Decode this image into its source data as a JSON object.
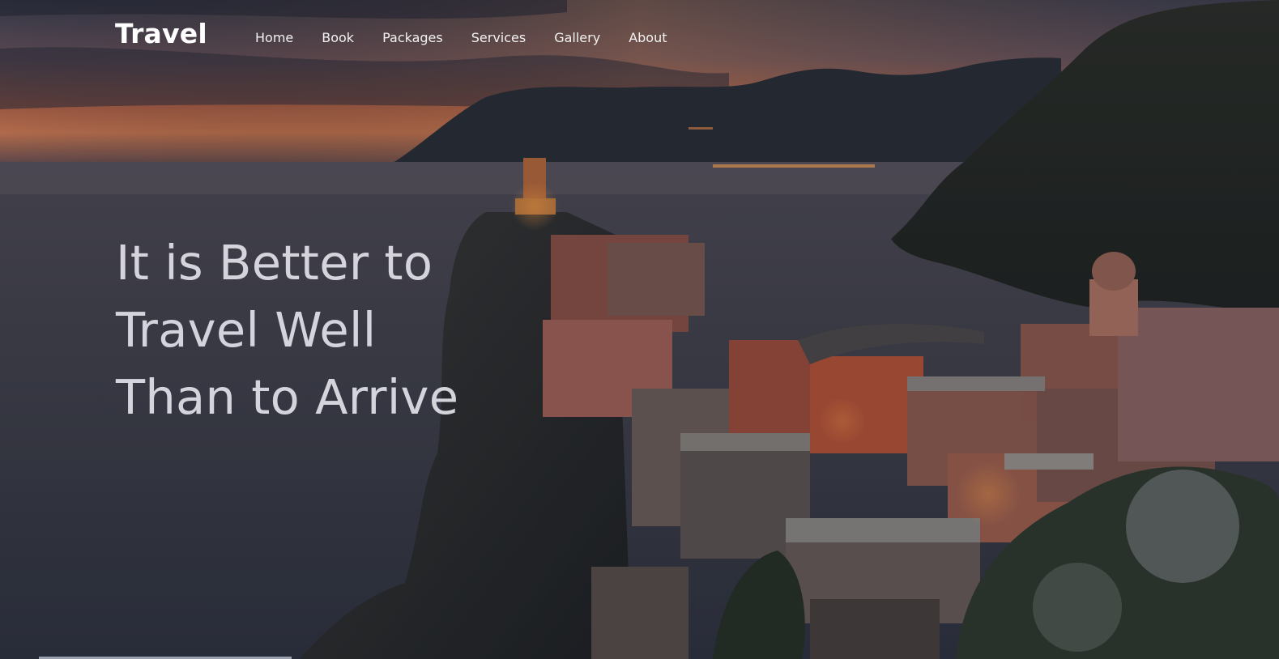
{
  "brand": {
    "name": "Travel"
  },
  "nav": {
    "items": [
      {
        "label": "Home"
      },
      {
        "label": "Book"
      },
      {
        "label": "Packages"
      },
      {
        "label": "Services"
      },
      {
        "label": "Gallery"
      },
      {
        "label": "About"
      }
    ]
  },
  "hero": {
    "headline_lines": [
      "It is Better to",
      "Travel Well",
      "Than to Arrive"
    ]
  },
  "colors": {
    "sky_top": "#3c3e4d",
    "sunset_glow": "#c9704a",
    "sea": "#3a3d4a",
    "mountain": "#2a2f38",
    "building_accent": "#c96a50",
    "headline_text": "#e2e2e9",
    "nav_text": "#f2f2f2"
  }
}
